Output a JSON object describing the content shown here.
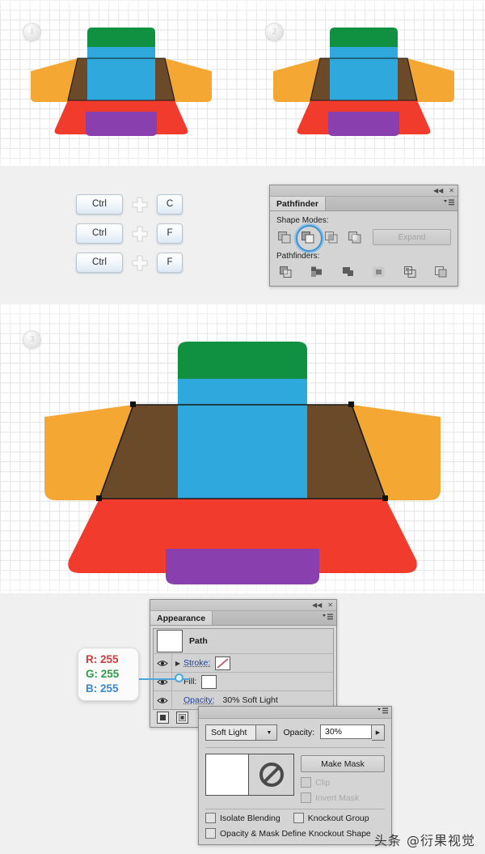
{
  "steps": [
    {
      "number": "1"
    },
    {
      "number": "2"
    },
    {
      "number": "3"
    }
  ],
  "illustration": {
    "colors": {
      "flap_left": "#f5a734",
      "flap_right": "#f5a734",
      "top_green": "#0f9141",
      "front_blue": "#2fa8dd",
      "inner_brown": "#6b4a2a",
      "bottom_red": "#f03b2d",
      "base_purple": "#8a3fae",
      "stroke": "#1a1a1a"
    }
  },
  "shortcuts": {
    "rows": [
      {
        "modifier": "Ctrl",
        "key": "C"
      },
      {
        "modifier": "Ctrl",
        "key": "F"
      },
      {
        "modifier": "Ctrl",
        "key": "F"
      }
    ],
    "plus_icon": "plus-icon"
  },
  "pathfinder": {
    "tab_label": "Pathfinder",
    "shape_modes_label": "Shape Modes:",
    "pathfinders_label": "Pathfinders:",
    "expand_label": "Expand",
    "shape_mode_buttons": [
      {
        "name": "unite-icon",
        "selected": false
      },
      {
        "name": "minus-front-icon",
        "selected": true
      },
      {
        "name": "intersect-icon",
        "selected": false
      },
      {
        "name": "exclude-icon",
        "selected": false
      }
    ],
    "pathfinder_buttons": [
      {
        "name": "divide-icon"
      },
      {
        "name": "trim-icon"
      },
      {
        "name": "merge-icon"
      },
      {
        "name": "crop-icon"
      },
      {
        "name": "outline-icon"
      },
      {
        "name": "minus-back-icon"
      }
    ],
    "collapse_icon": "collapse-icon",
    "close_icon": "close-icon",
    "menu_icon": "panel-menu-icon"
  },
  "appearance": {
    "tab_label": "Appearance",
    "path_label": "Path",
    "rows": [
      {
        "label": "Stroke:",
        "eye": "eye-icon",
        "swatch": "stroke-none-swatch"
      },
      {
        "label": "Fill:",
        "eye": "eye-icon",
        "swatch": "fill-white-swatch"
      },
      {
        "label": "Opacity:",
        "value": "30% Soft Light",
        "eye": "eye-icon"
      }
    ],
    "footer_icons": [
      "add-new-stroke-icon",
      "add-new-fill-icon"
    ],
    "collapse_icon": "collapse-icon",
    "close_icon": "close-icon",
    "menu_icon": "panel-menu-icon"
  },
  "transparency": {
    "blend_mode": "Soft Light",
    "opacity_label": "Opacity:",
    "opacity_value": "30%",
    "make_mask_label": "Make Mask",
    "clip_label": "Clip",
    "invert_mask_label": "Invert Mask",
    "isolate_blending_label": "Isolate Blending",
    "knockout_group_label": "Knockout Group",
    "knockout_shape_label": "Opacity & Mask Define Knockout Shape",
    "menu_icon": "panel-menu-icon",
    "no-symbol": "no-mask-icon"
  },
  "rgb_callout": {
    "r": "R: 255",
    "g": "G: 255",
    "b": "B: 255"
  },
  "watermark": {
    "text": "头条 @衍果视觉"
  }
}
